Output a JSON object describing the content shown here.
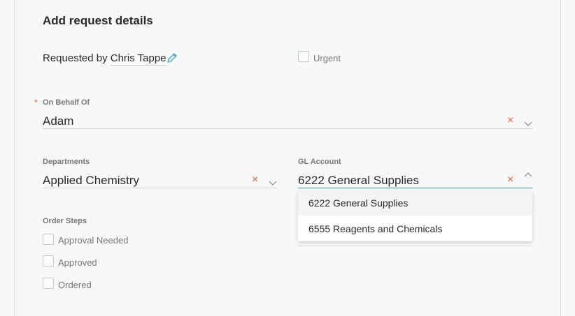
{
  "header": {
    "title": "Add request details"
  },
  "requester": {
    "prefix": "Requested by",
    "name": "Chris Tappe"
  },
  "urgent": {
    "label": "Urgent"
  },
  "on_behalf_of": {
    "required_mark": "*",
    "label": "On Behalf Of",
    "value": "Adam"
  },
  "departments": {
    "label": "Departments",
    "value": "Applied Chemistry"
  },
  "gl_account": {
    "label": "GL Account",
    "value": "6222 General Supplies",
    "options": [
      "6222 General Supplies",
      "6555 Reagents and Chemicals"
    ]
  },
  "order_steps": {
    "label": "Order Steps",
    "items": [
      "Approval Needed",
      "Approved",
      "Ordered"
    ]
  },
  "icons": {
    "clear": "×"
  },
  "colors": {
    "accent": "#e0622e",
    "focus_underline": "#3b8a9a",
    "pencil": "#4aa7c9"
  }
}
